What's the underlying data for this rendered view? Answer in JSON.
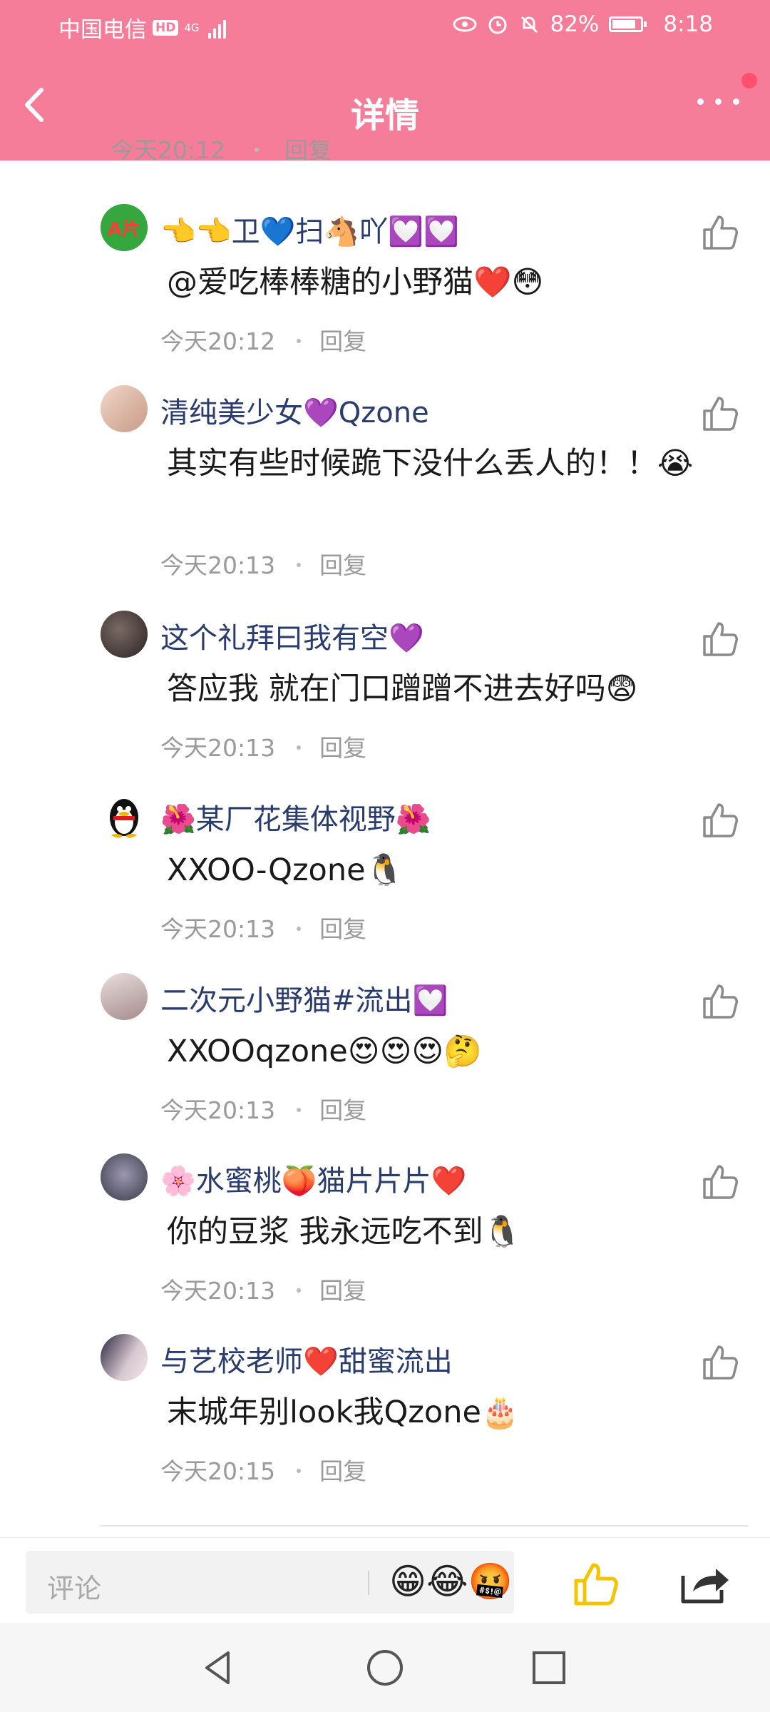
{
  "status_bar": {
    "carrier": "中国电信",
    "hd_badge": "HD",
    "network": "4G",
    "battery": "82%",
    "battery_level": 0.82,
    "time": "8:18"
  },
  "header": {
    "title": "详情",
    "back_icon": "chevron-left-icon",
    "more_icon": "more-dots-icon"
  },
  "partial_previous": {
    "time": "今天20:12",
    "reply": "回复"
  },
  "comments": [
    {
      "name": "👈👈卫💙扫🐴吖💟💟",
      "text": "@爱吃棒棒糖的小野猫❤️😳",
      "time": "今天20:12",
      "reply": "回复",
      "avatar": "avatar-ap"
    },
    {
      "name": "清纯美少女💜Qzone",
      "text": "其实有些时候跪下没什么丢人的！！😭",
      "time": "今天20:13",
      "reply": "回复",
      "avatar": "avatar-girl"
    },
    {
      "name": "这个礼拜曰我有空💜",
      "text": "答应我 就在门口蹭蹭不进去好吗😨",
      "time": "今天20:13",
      "reply": "回复",
      "avatar": "avatar-dark"
    },
    {
      "name": "🌺某厂花集体视野🌺",
      "text": "XXOO-Qzone🐧",
      "time": "今天20:13",
      "reply": "回复",
      "avatar": "avatar-penguin"
    },
    {
      "name": "二次元小野猫#流出💟",
      "text": "XXOOqzone😍😍😍🤔",
      "time": "今天20:13",
      "reply": "回复",
      "avatar": "avatar-girl2"
    },
    {
      "name": "🌸水蜜桃🍑猫片片片❤️",
      "text": "你的豆浆 我永远吃不到🐧",
      "time": "今天20:13",
      "reply": "回复",
      "avatar": "avatar-gray"
    },
    {
      "name": "与艺校老师❤️甜蜜流出",
      "text": "末城年别look我Qzone🎂",
      "time": "今天20:15",
      "reply": "回复",
      "avatar": "avatar-photo"
    }
  ],
  "bottom_bar": {
    "placeholder": "评论",
    "emoji_strip": "😁😂🤬",
    "like_icon": "thumbs-up-icon",
    "share_icon": "share-icon"
  },
  "nav_bar": {
    "back_icon": "triangle-back-icon",
    "home_icon": "circle-home-icon",
    "recents_icon": "square-recents-icon"
  },
  "colors": {
    "header_bg": "#f67d9a",
    "name_color": "#2a3c6e",
    "meta_color": "#9a9a9a",
    "like_active": "#f5c400"
  }
}
